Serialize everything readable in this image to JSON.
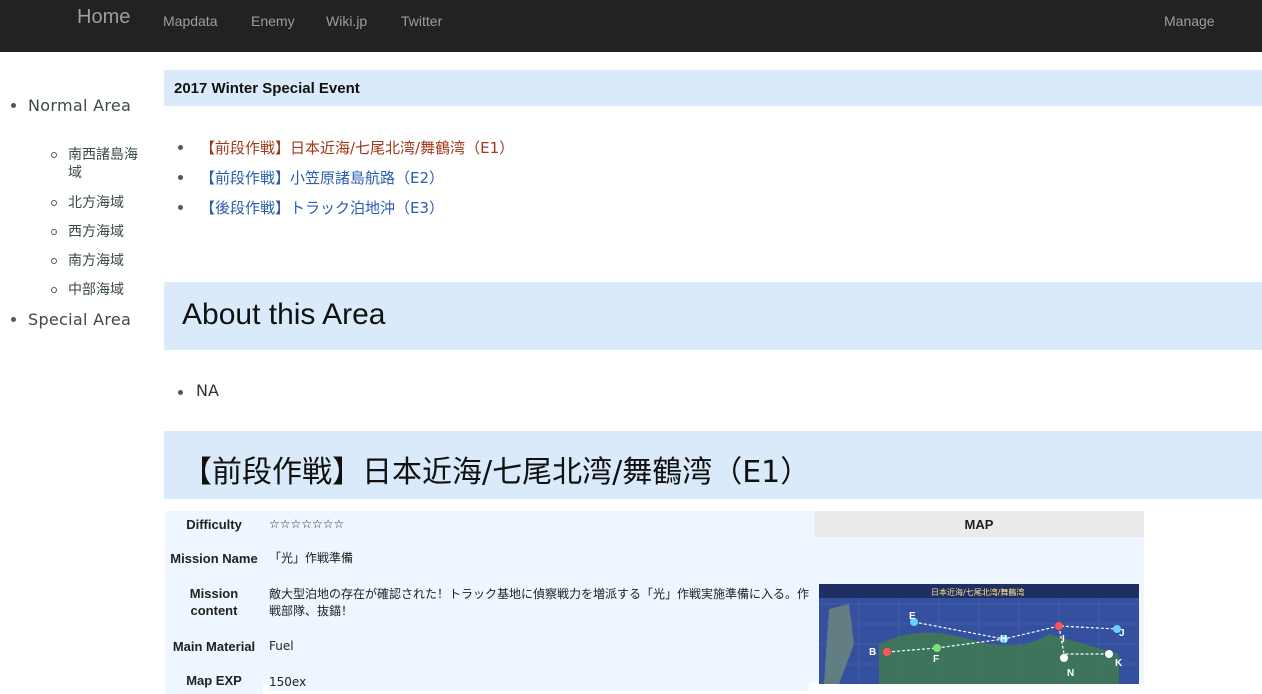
{
  "nav": {
    "home": "Home",
    "links": [
      "Mapdata",
      "Enemy",
      "Wiki.jp",
      "Twitter"
    ],
    "manage": "Manage"
  },
  "sidebar": {
    "normal_area": "Normal Area",
    "sub_items": [
      "南西諸島海域",
      "北方海域",
      "西方海域",
      "南方海域",
      "中部海域"
    ],
    "special_area": "Special Area"
  },
  "event": {
    "title": "2017 Winter Special Event",
    "maps": [
      "【前段作戦】日本近海/七尾北湾/舞鶴湾（E1）",
      "【前段作戦】小笠原諸島航路（E2）",
      "【後段作戦】トラック泊地沖（E3）"
    ]
  },
  "about": {
    "title": "About this Area",
    "items": [
      "NA"
    ]
  },
  "section_e1": {
    "title": "【前段作戦】日本近海/七尾北湾/舞鶴湾（E1）",
    "rows": [
      {
        "label": "Difficulty",
        "value": "☆☆☆☆☆☆☆"
      },
      {
        "label": "Mission Name",
        "value": "「光」作戦準備"
      },
      {
        "label": "Mission content",
        "value": "敵大型泊地の存在が確認された！トラック基地に偵察戦力を増派する「光」作戦実施準備に入る。作戦部隊、抜錨！"
      },
      {
        "label": "Main Material",
        "value": "Fuel"
      },
      {
        "label": "Map EXP",
        "value": "150ex"
      }
    ],
    "map_header": "MAP",
    "map_banner": "日本近海/七尾北湾/舞鶴湾",
    "map_nodes": [
      "E",
      "H",
      "I",
      "J",
      "B",
      "F",
      "N",
      "K"
    ]
  },
  "colors": {
    "navbar_bg": "#222222",
    "nav_text": "#9d9d9d",
    "header_bg": "#daeafa",
    "table_bg": "#eef6ff",
    "link_active": "#a0391b",
    "link": "#2a5db0"
  }
}
